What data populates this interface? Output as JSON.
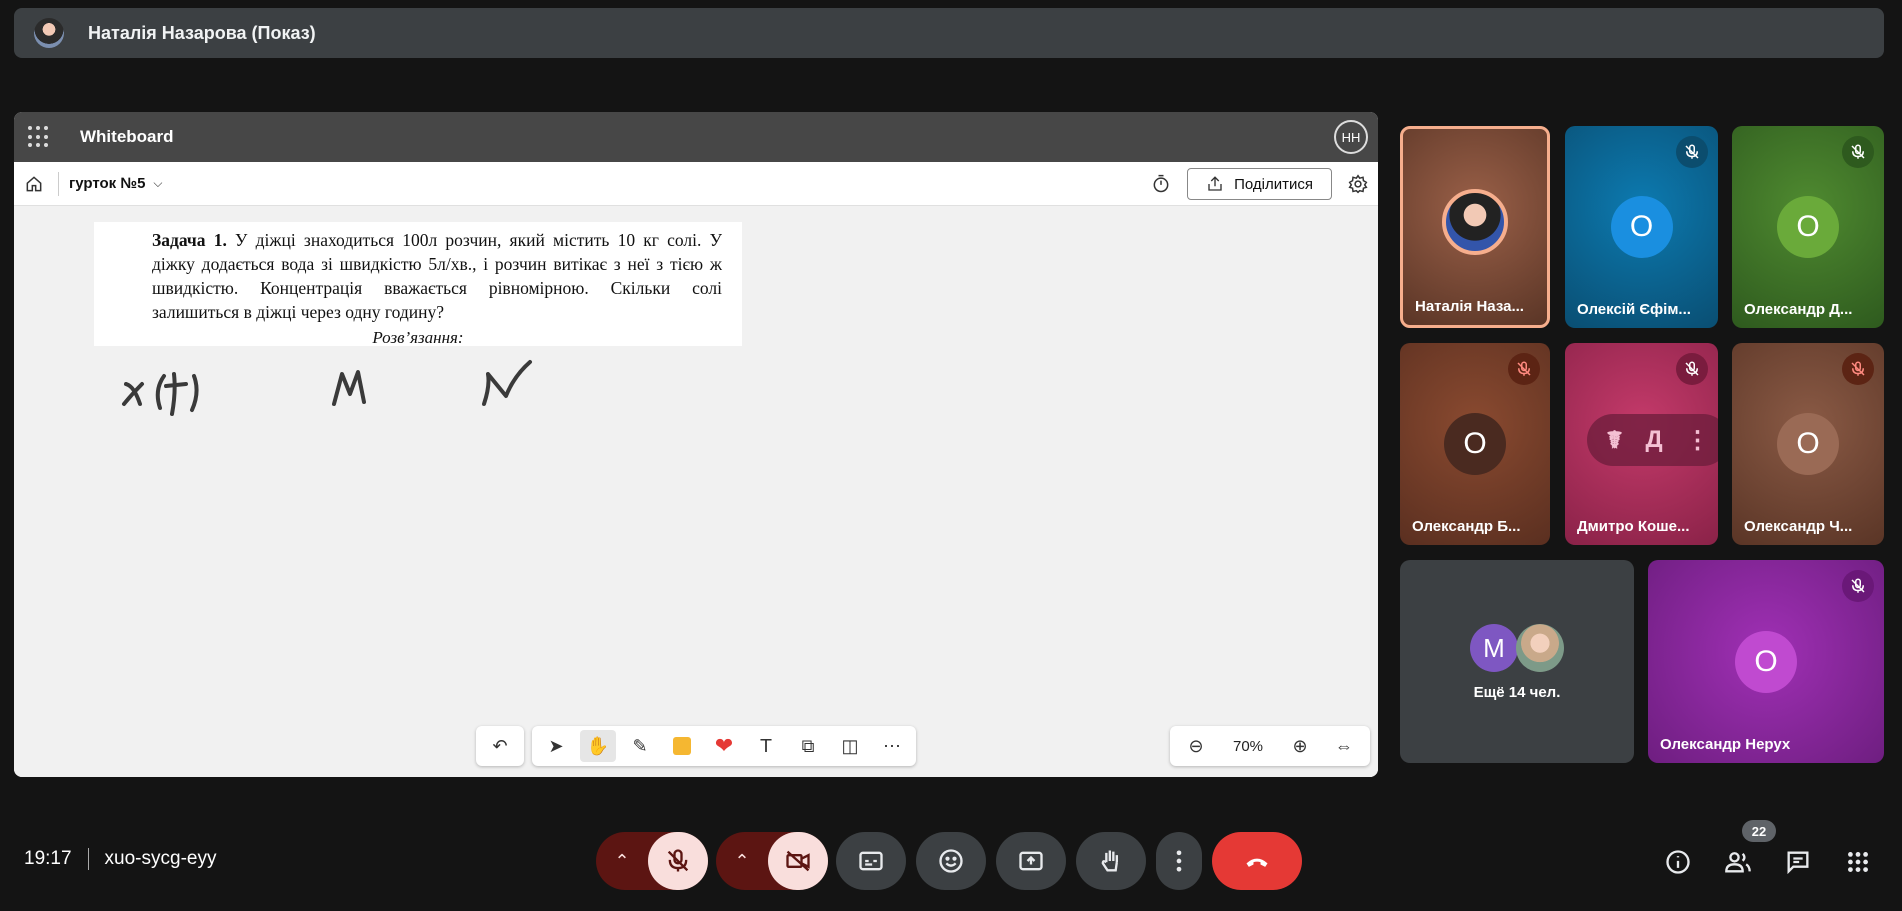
{
  "presenter_bar": {
    "title": "Наталія Назарова (Показ)"
  },
  "whiteboard": {
    "app_title": "Whiteboard",
    "user_initials": "НН",
    "board_name": "гурток №5",
    "share_label": "Поділитися",
    "document": {
      "task_label": "Задача 1.",
      "task_text": "У діжці знаходиться 100л розчин, який містить 10 кг солі. У діжку додається вода зі швидкістю 5л/хв., і розчин витікає з неї з тією ж швидкістю. Концентрація вважається рівномірною. Скільки солі залишиться в діжці через одну годину?",
      "solution_label": "Розв’язання:"
    },
    "zoom": "70%"
  },
  "participants": [
    {
      "name": "Наталія Наза...",
      "initial": "",
      "muted": false,
      "bg": "#7a4a35",
      "speaking": true
    },
    {
      "name": "Олексій Єфім...",
      "initial": "О",
      "muted": true,
      "bg": "#0a5f8a",
      "avatar_color": "#1a8fe0"
    },
    {
      "name": "Олександр Д...",
      "initial": "О",
      "muted": true,
      "bg": "#3d6e2a",
      "avatar_color": "#6aaa3a"
    },
    {
      "name": "Олександр Б...",
      "initial": "О",
      "muted": true,
      "bg": "#6b3a26",
      "avatar_color": "#4a2a20"
    },
    {
      "name": "Дмитро Коше...",
      "initial": "Д",
      "muted": true,
      "bg": "#b0325e"
    },
    {
      "name": "Олександр Ч...",
      "initial": "О",
      "muted": true,
      "bg": "#7a4a35",
      "avatar_color": "#9a6a55"
    },
    {
      "name": "Олександр Нерух",
      "initial": "О",
      "muted": true,
      "bg": "#8e2a9e",
      "avatar_color": "#c04ad0"
    }
  ],
  "more_tile": {
    "label": "Ещё 14 чел.",
    "initial": "М"
  },
  "footer": {
    "time": "19:17",
    "meeting_code": "xuo-sycg-eyy",
    "participants_count": "22"
  },
  "colors": {
    "end_call": "#e53935",
    "mic_off_bg": "#f9dedc",
    "ctrl_bg": "#3c4043",
    "dark_red": "#5c1512"
  }
}
